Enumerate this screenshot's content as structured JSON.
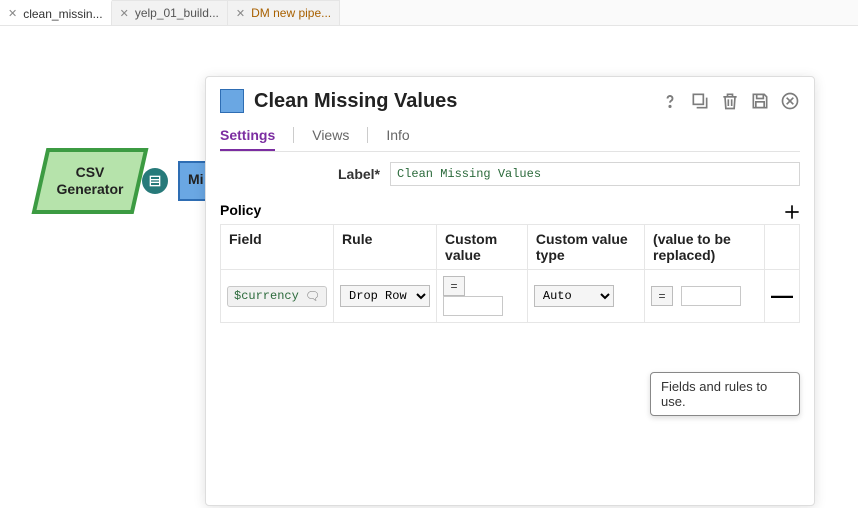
{
  "tabs": [
    {
      "label": "clean_missin...",
      "active": true
    },
    {
      "label": "yelp_01_build...",
      "active": false
    },
    {
      "label": "DM new pipe...",
      "active": false,
      "accent": true
    }
  ],
  "canvas": {
    "csv_node_label": "CSV Generator",
    "mi_node_label": "Mi"
  },
  "panel": {
    "title": "Clean Missing Values",
    "tabs": {
      "settings": "Settings",
      "views": "Views",
      "info": "Info"
    },
    "label_field": "Label*",
    "label_value": "Clean Missing Values",
    "policy_heading": "Policy",
    "columns": {
      "field": "Field",
      "rule": "Rule",
      "custom_value": "Custom value",
      "custom_value_type": "Custom value type",
      "replaced": "(value to be replaced)"
    },
    "row": {
      "field_value": "$currency",
      "rule_value": "Drop Row",
      "eq": "=",
      "custom_value": "",
      "custom_value_type": "Auto",
      "replaced_value": ""
    },
    "tooltip": "Fields and rules to use."
  }
}
